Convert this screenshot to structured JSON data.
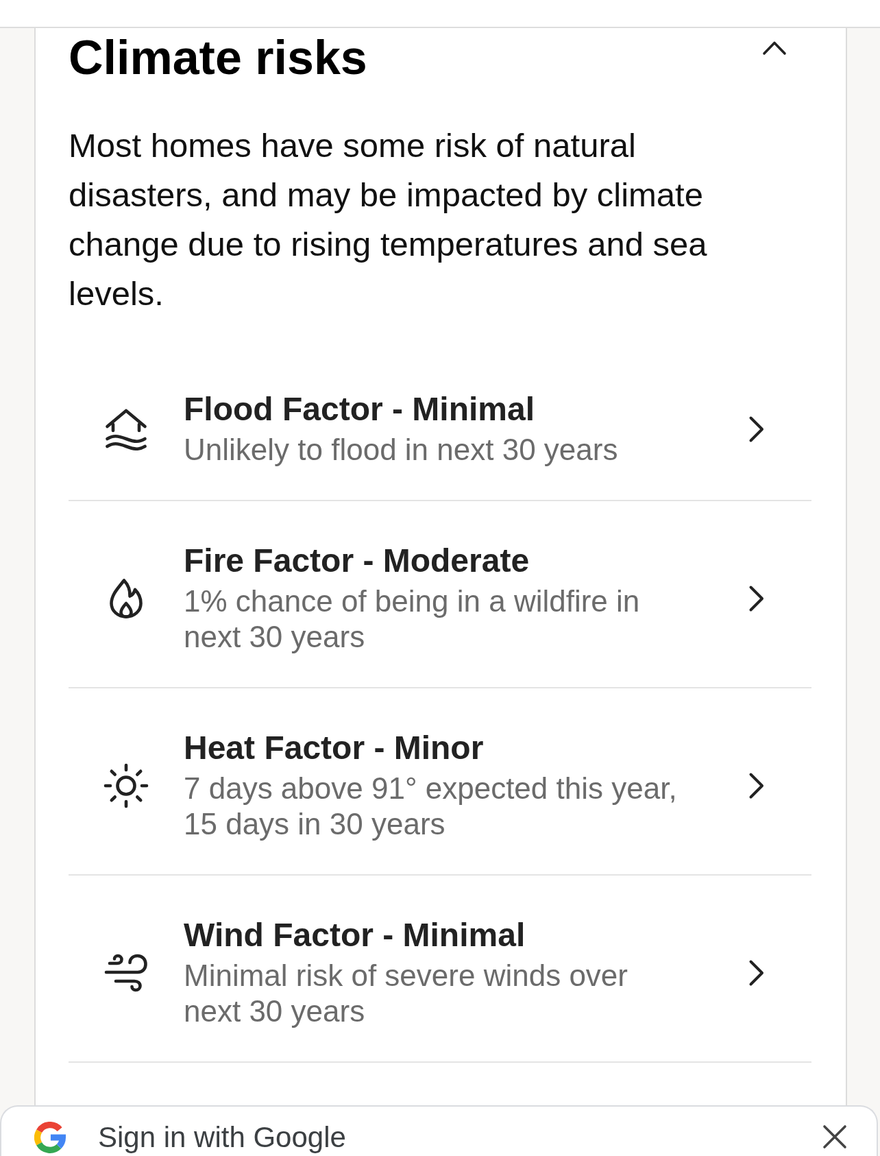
{
  "section": {
    "title": "Climate risks",
    "expanded": true,
    "description": "Most homes have some risk of natural disasters, and may be impacted by climate change due to rising temperatures and sea levels."
  },
  "risk_factors": [
    {
      "kind": "flood",
      "title": "Flood Factor - Minimal",
      "subtitle": "Unlikely to flood in next 30 years"
    },
    {
      "kind": "fire",
      "title": "Fire Factor - Moderate",
      "subtitle": "1% chance of being in a wildfire in next 30 years"
    },
    {
      "kind": "heat",
      "title": "Heat Factor - Minor",
      "subtitle": "7 days above 91° expected this year, 15 days in 30 years"
    },
    {
      "kind": "wind",
      "title": "Wind Factor - Minimal",
      "subtitle": "Minimal risk of severe winds over next 30 years"
    }
  ],
  "sign_in_prompt": {
    "label": "Sign in with Google"
  }
}
